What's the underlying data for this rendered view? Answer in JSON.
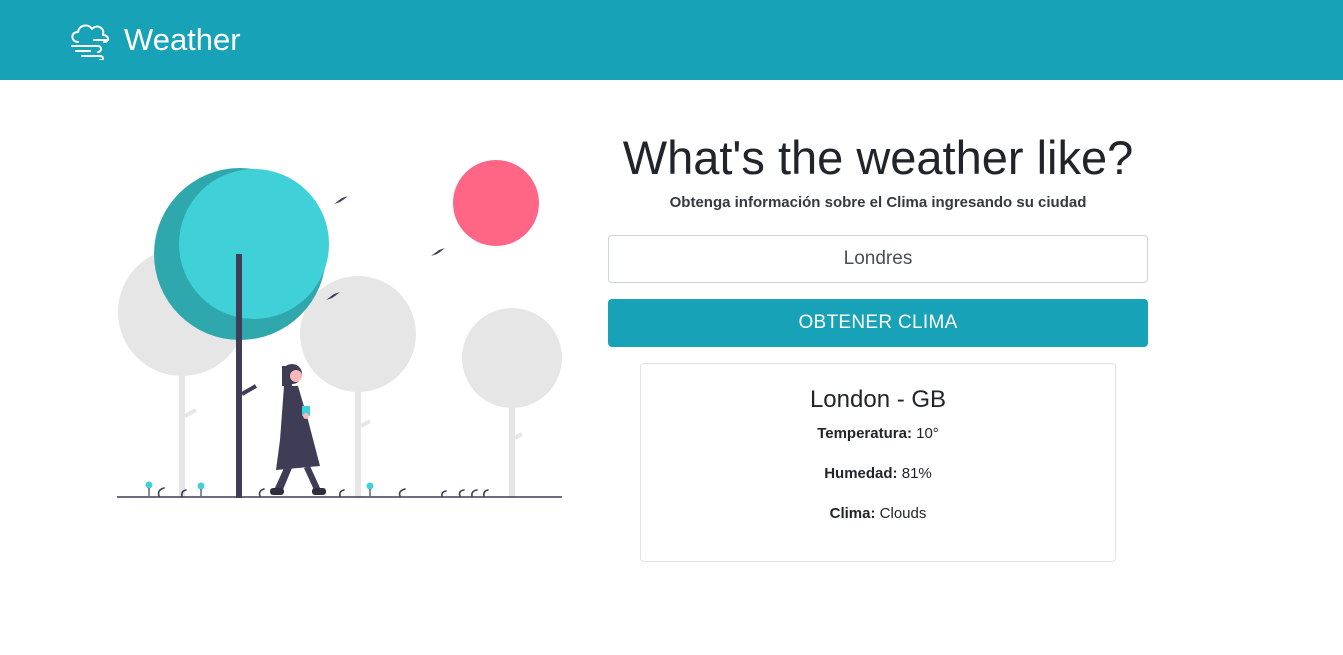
{
  "navbar": {
    "brand_text": "Weather",
    "brand_icon": "cloud-wind-icon",
    "background_color": "#17a2b8"
  },
  "hero": {
    "title": "What's the weather like?",
    "subtitle": "Obtenga información sobre el Clima ingresando su ciudad"
  },
  "form": {
    "city_value": "Londres",
    "submit_label": "OBTENER CLIMA"
  },
  "result": {
    "location": "London - GB",
    "temperature_label": "Temperatura:",
    "temperature_value": "10°",
    "humidity_label": "Humedad:",
    "humidity_value": "81%",
    "sky_label": "Clima:",
    "sky_value": "Clouds"
  },
  "colors": {
    "accent": "#17a2b8",
    "sun": "#ff6584",
    "tree_primary": "#3fd0d8",
    "tree_grey": "#e6e6e6",
    "dark": "#3f3d56"
  }
}
